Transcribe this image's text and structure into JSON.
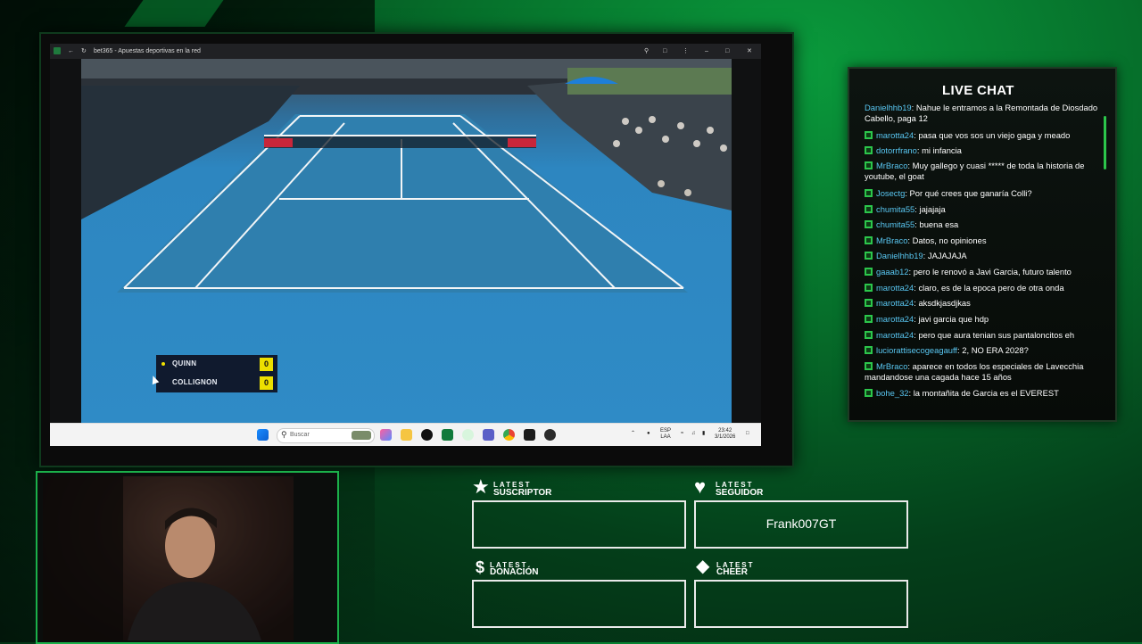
{
  "browser": {
    "tab_title": "bet365 - Apuestas deportivas en la red",
    "icons": [
      "back-arrow-icon",
      "reload-icon",
      "zoom-icon",
      "extensions-icon",
      "menu-icon",
      "minimize-icon",
      "maximize-icon",
      "close-icon"
    ]
  },
  "scoreboard": {
    "players": [
      {
        "name": "QUINN",
        "score": "0",
        "serving": true
      },
      {
        "name": "COLLIGNON",
        "score": "0",
        "serving": false
      }
    ]
  },
  "taskbar": {
    "search_placeholder": "Buscar",
    "lang_line1": "ESP",
    "lang_line2": "LAA",
    "time": "23:42",
    "date": "3/1/2026"
  },
  "chat": {
    "title": "LIVE CHAT",
    "messages": [
      {
        "user": "Danielhhb19",
        "text": "Nahue le entramos a la Remontada de Diosdado Cabello, paga 12"
      },
      {
        "user": "marotta24",
        "text": "pasa que vos sos un viejo gaga y meado"
      },
      {
        "user": "dotorrfrano",
        "text": "mi infancia"
      },
      {
        "user": "MrBraco",
        "text": "Muy gallego y cuasi ***** de toda la historia de youtube, el goat"
      },
      {
        "user": "Josectg",
        "text": "Por qué crees que ganaría Colli?"
      },
      {
        "user": "chumita55",
        "text": "jajajaja"
      },
      {
        "user": "chumita55",
        "text": "buena esa"
      },
      {
        "user": "MrBraco",
        "text": "Datos, no opiniones"
      },
      {
        "user": "Danielhhb19",
        "text": "JAJAJAJA"
      },
      {
        "user": "gaaab12",
        "text": "pero le renovó a Javi Garcia, futuro talento"
      },
      {
        "user": "marotta24",
        "text": "claro, es de la epoca pero de otra onda"
      },
      {
        "user": "marotta24",
        "text": "aksdkjasdjkas"
      },
      {
        "user": "marotta24",
        "text": "javi garcia que hdp"
      },
      {
        "user": "marotta24",
        "text": "pero que aura tenian sus pantaloncitos eh"
      },
      {
        "user": "luciorattisecogeagauff",
        "text": "2, NO ERA 2028?"
      },
      {
        "user": "MrBraco",
        "text": "aparece en todos los especiales de Lavecchia mandandose una cagada hace 15 años"
      },
      {
        "user": "bohe_32",
        "text": "la montañita de Garcia es el EVEREST"
      }
    ]
  },
  "alerts": {
    "suscriptor": {
      "small": "LATEST",
      "big": "SUSCRIPTOR",
      "value": "",
      "icon": "star-icon"
    },
    "seguidor": {
      "small": "LATEST",
      "big": "SEGUIDOR",
      "value": "Frank007GT",
      "icon": "heart-icon"
    },
    "donacion": {
      "small": "LATEST",
      "big": "DONACIÓN",
      "value": "",
      "icon": "dollar-icon"
    },
    "cheer": {
      "small": "LATEST",
      "big": "CHEER",
      "value": "",
      "icon": "diamond-icon"
    }
  },
  "colors": {
    "accent_green": "#2cc64b",
    "chat_username": "#59c7f2",
    "score_yellow": "#ecdf00",
    "court_blue": "#2f8bc6"
  }
}
